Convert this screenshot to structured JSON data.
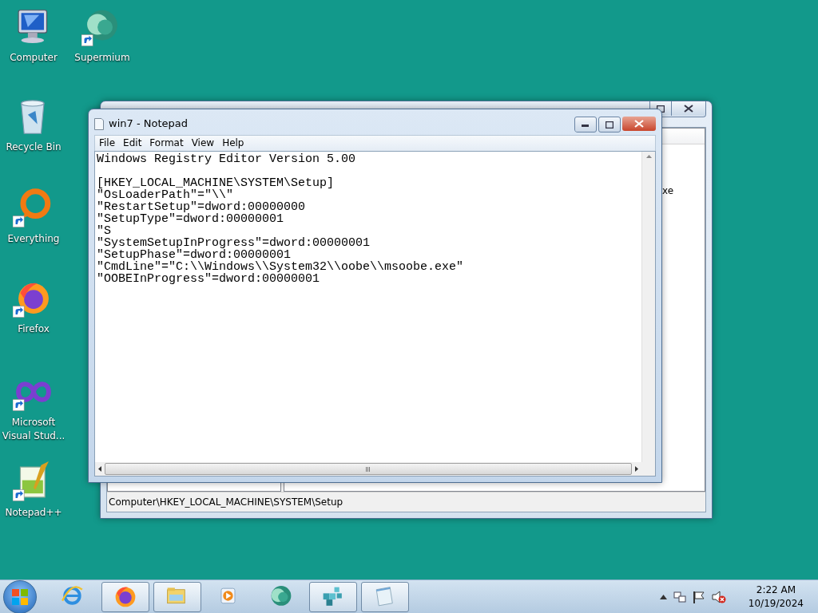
{
  "desktop_icons": [
    {
      "label": "Computer",
      "kind": "computer",
      "shortcut": false
    },
    {
      "label": "Supermium",
      "kind": "sphere",
      "shortcut": true
    },
    {
      "label": "Recycle Bin",
      "kind": "bin",
      "shortcut": false
    },
    {
      "label": "Everything",
      "kind": "ring",
      "shortcut": true
    },
    {
      "label": "Firefox",
      "kind": "fox",
      "shortcut": true
    },
    {
      "label": "Microsoft Visual Stud...",
      "kind": "infinity",
      "shortcut": true
    },
    {
      "label": "Notepad++",
      "kind": "pad",
      "shortcut": true
    }
  ],
  "registry_window": {
    "visible_value": "xe",
    "status_bar": "Computer\\HKEY_LOCAL_MACHINE\\SYSTEM\\Setup"
  },
  "notepad": {
    "title": "win7 - Notepad",
    "menu": [
      "File",
      "Edit",
      "Format",
      "View",
      "Help"
    ],
    "header": "Windows Registry Editor Version 5.00",
    "lines": [
      "[HKEY_LOCAL_MACHINE\\SYSTEM\\Setup]",
      "\"OsLoaderPath\"=\"\\\\\"",
      "\"RestartSetup\"=dword:00000000",
      "\"SetupType\"=dword:00000001",
      "\"S",
      "\"SystemSetupInProgress\"=dword:00000001",
      "\"SetupPhase\"=dword:00000001",
      "\"CmdLine\"=\"C:\\\\Windows\\\\System32\\\\oobe\\\\msoobe.exe\"",
      "\"OOBEInProgress\"=dword:00000001"
    ]
  },
  "taskbar": {
    "items": [
      {
        "kind": "ie",
        "running": false
      },
      {
        "kind": "fox",
        "running": true
      },
      {
        "kind": "folder",
        "running": true
      },
      {
        "kind": "media",
        "running": false
      },
      {
        "kind": "sphere",
        "running": false
      },
      {
        "kind": "registry",
        "running": true
      },
      {
        "kind": "notepad",
        "running": true
      }
    ],
    "clock": {
      "time": "2:22 AM",
      "date": "10/19/2024"
    }
  }
}
